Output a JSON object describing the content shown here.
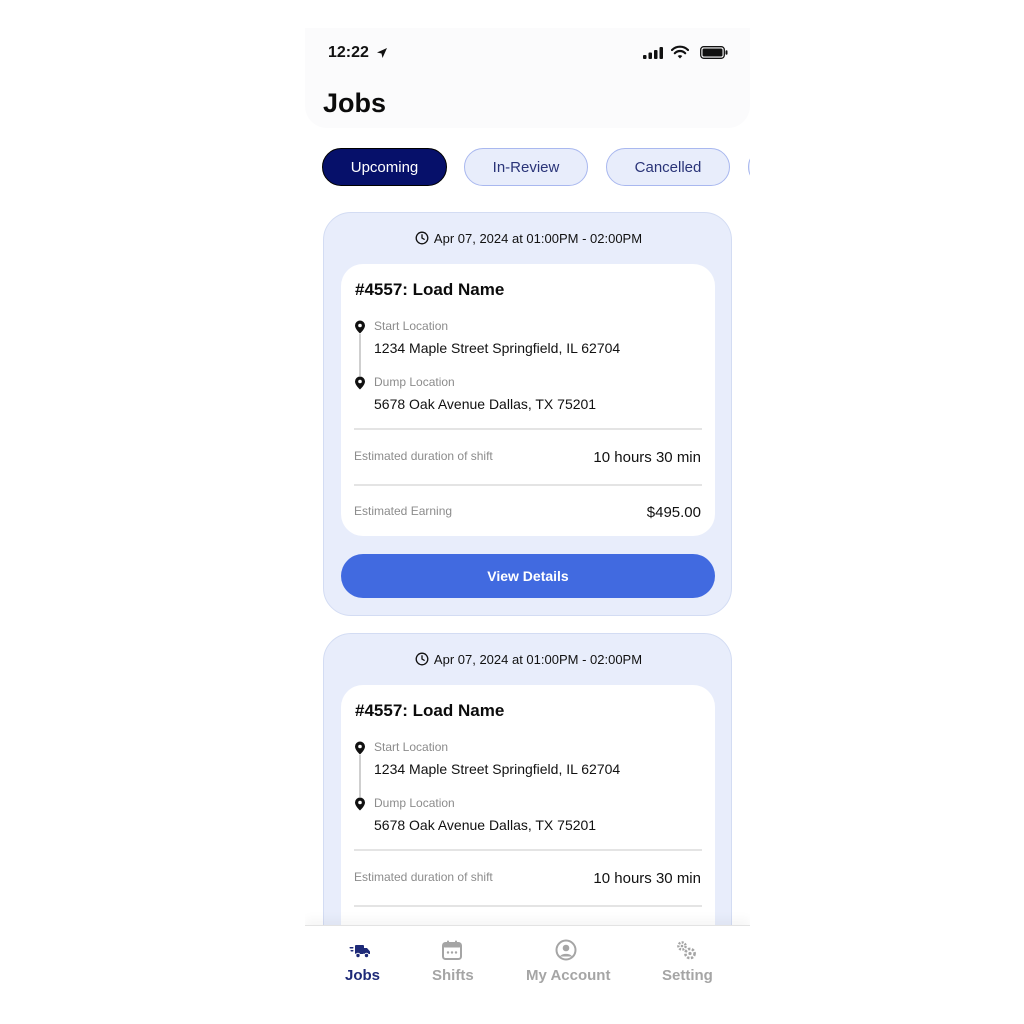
{
  "status_bar": {
    "time": "12:22"
  },
  "page": {
    "title": "Jobs"
  },
  "tabs": [
    {
      "label": "Upcoming",
      "active": true
    },
    {
      "label": "In-Review",
      "active": false
    },
    {
      "label": "Cancelled",
      "active": false
    }
  ],
  "jobs": [
    {
      "datetime": "Apr 07, 2024 at 01:00PM - 02:00PM",
      "title": "#4557: Load Name",
      "start_label": "Start Location",
      "start_value": "1234 Maple Street Springfield, IL 62704",
      "dump_label": "Dump Location",
      "dump_value": "5678 Oak Avenue Dallas, TX 75201",
      "duration_label": "Estimated duration of shift",
      "duration_value": "10 hours 30 min",
      "earning_label": "Estimated Earning",
      "earning_value": "$495.00",
      "button_label": "View Details"
    },
    {
      "datetime": "Apr 07, 2024 at 01:00PM - 02:00PM",
      "title": "#4557: Load Name",
      "start_label": "Start Location",
      "start_value": "1234 Maple Street Springfield, IL 62704",
      "dump_label": "Dump Location",
      "dump_value": "5678 Oak Avenue Dallas, TX 75201",
      "duration_label": "Estimated duration of shift",
      "duration_value": "10 hours 30 min"
    }
  ],
  "bottom_nav": [
    {
      "label": "Jobs",
      "icon": "truck-icon",
      "active": true
    },
    {
      "label": "Shifts",
      "icon": "calendar-icon",
      "active": false
    },
    {
      "label": "My Account",
      "icon": "account-icon",
      "active": false
    },
    {
      "label": "Setting",
      "icon": "gears-icon",
      "active": false
    }
  ],
  "colors": {
    "accent": "#416ae0",
    "tab_active": "#06106a",
    "card_bg": "#e8edfb",
    "nav_active": "#1e2a78",
    "nav_inactive": "#a5a5a5"
  }
}
